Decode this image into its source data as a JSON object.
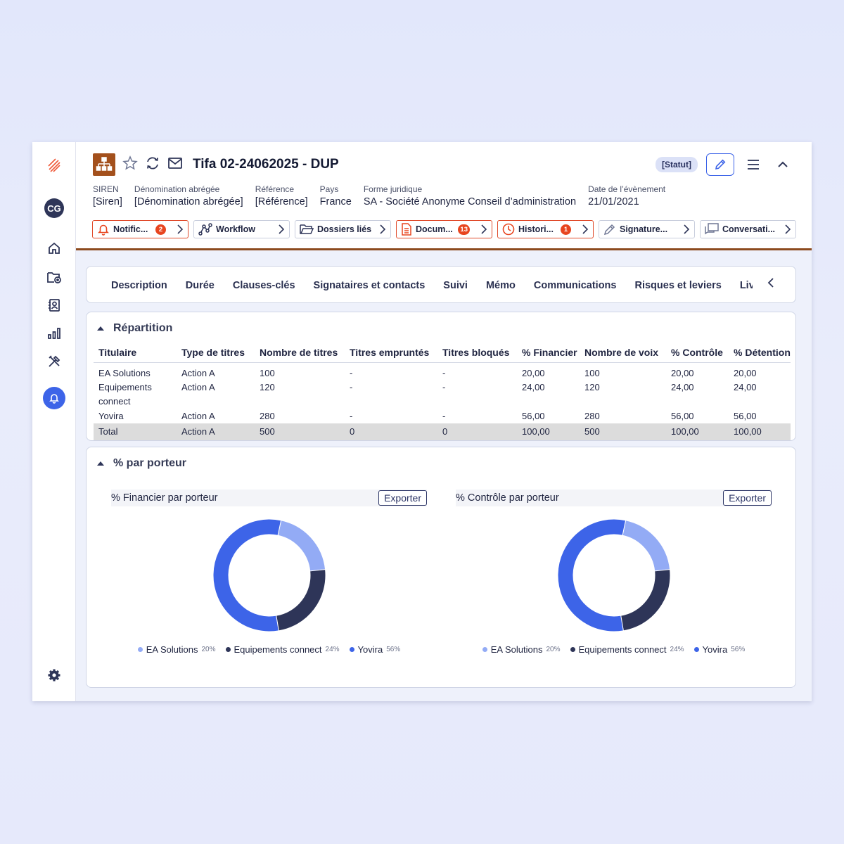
{
  "rail": {
    "avatar": "CG"
  },
  "header": {
    "title": "Tifa 02-24062025 - DUP",
    "status": "[Statut]"
  },
  "meta": [
    {
      "label": "SIREN",
      "value": "[Siren]"
    },
    {
      "label": "Dénomination abrégée",
      "value": "[Dénomination abrégée]"
    },
    {
      "label": "Référence",
      "value": "[Référence]"
    },
    {
      "label": "Pays",
      "value": "France"
    },
    {
      "label": "Forme juridique",
      "value": "SA - Société Anonyme Conseil d’administration"
    },
    {
      "label": "Date de l’évènement",
      "value": "21/01/2021"
    }
  ],
  "chips": [
    {
      "label": "Notific...",
      "badge": "2",
      "icon": "bell-icon"
    },
    {
      "label": "Workflow",
      "badge": "",
      "icon": "workflow-icon"
    },
    {
      "label": "Dossiers liés",
      "badge": "",
      "icon": "folder-icon"
    },
    {
      "label": "Docum...",
      "badge": "13",
      "icon": "document-icon"
    },
    {
      "label": "Histori...",
      "badge": "1",
      "icon": "clock-icon"
    },
    {
      "label": "Signature...",
      "badge": "",
      "icon": "pen-icon"
    },
    {
      "label": "Conversati...",
      "badge": "",
      "icon": "chat-icon"
    }
  ],
  "tabs": [
    "Description",
    "Durée",
    "Clauses-clés",
    "Signataires et contacts",
    "Suivi",
    "Mémo",
    "Communications",
    "Risques et leviers",
    "Livrables"
  ],
  "repartition": {
    "title": "Répartition",
    "headers": [
      "Titulaire",
      "Type de titres",
      "Nombre de titres",
      "Titres empruntés",
      "Titres bloqués",
      "% Financier",
      "Nombre de voix",
      "% Contrôle",
      "% Détention"
    ],
    "rows": [
      {
        "titulaire": "EA Solutions",
        "type": "Action A",
        "nombre": "100",
        "empruntes": "-",
        "bloques": "-",
        "financier": "20,00",
        "voix": "100",
        "controle": "20,00",
        "detention": "20,00"
      },
      {
        "titulaire": "Equipements connect",
        "type": "Action A",
        "nombre": "120",
        "empruntes": "-",
        "bloques": "-",
        "financier": "24,00",
        "voix": "120",
        "controle": "24,00",
        "detention": "24,00"
      },
      {
        "titulaire": "Yovira",
        "type": "Action A",
        "nombre": "280",
        "empruntes": "-",
        "bloques": "-",
        "financier": "56,00",
        "voix": "280",
        "controle": "56,00",
        "detention": "56,00"
      }
    ],
    "total": {
      "titulaire": "Total",
      "type": "Action A",
      "nombre": "500",
      "empruntes": "0",
      "bloques": "0",
      "financier": "100,00",
      "voix": "500",
      "controle": "100,00",
      "detention": "100,00"
    }
  },
  "porteur": {
    "title": "% par porteur",
    "export_label": "Exporter"
  },
  "chart_data": [
    {
      "type": "pie",
      "title": "% Financier par porteur",
      "categories": [
        "EA Solutions",
        "Equipements connect",
        "Yovira"
      ],
      "values": [
        20,
        24,
        56
      ],
      "value_labels": [
        "20%",
        "24%",
        "56%"
      ],
      "colors": [
        "#93abf5",
        "#2e3558",
        "#3d64e8"
      ],
      "donut": true,
      "legend": "bottom"
    },
    {
      "type": "pie",
      "title": "% Contrôle par porteur",
      "categories": [
        "EA Solutions",
        "Equipements connect",
        "Yovira"
      ],
      "values": [
        20,
        24,
        56
      ],
      "value_labels": [
        "20%",
        "24%",
        "56%"
      ],
      "colors": [
        "#93abf5",
        "#2e3558",
        "#3d64e8"
      ],
      "donut": true,
      "legend": "bottom"
    }
  ]
}
